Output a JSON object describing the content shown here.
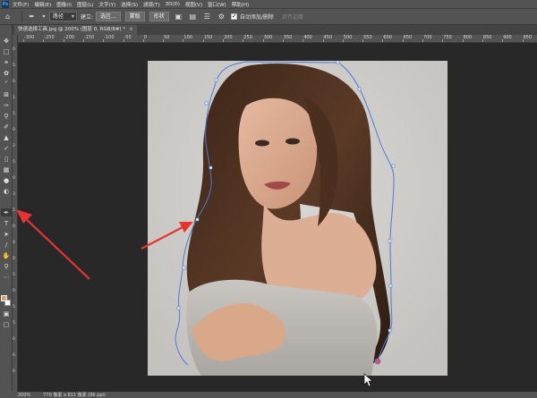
{
  "menubar": {
    "items": [
      "文件(F)",
      "编辑(E)",
      "图像(I)",
      "图层(L)",
      "文字(Y)",
      "选择(S)",
      "滤镜(T)",
      "3D(D)",
      "视图(V)",
      "窗口(W)",
      "帮助(H)"
    ]
  },
  "options": {
    "mode_select": "路径",
    "make_label": "建立:",
    "selection_btn": "选区...",
    "mask_btn": "蒙版",
    "shape_btn": "形状",
    "auto_add_label": "自动添加/删除",
    "align_edges_label": "对齐边缘"
  },
  "document": {
    "tab_title": "快速选择工具.jpg @ 200% (图层 0, RGB/8#) *"
  },
  "ruler": {
    "h_labels": [
      "-300",
      "-250",
      "-200",
      "-150",
      "-100",
      "-50",
      "0",
      "50",
      "100",
      "150",
      "200",
      "250",
      "300",
      "350",
      "400",
      "450",
      "500",
      "550",
      "600",
      "650",
      "700",
      "750",
      "800",
      "850",
      "900",
      "950"
    ],
    "v_labels": [
      "0",
      "5",
      "0",
      "1",
      "5",
      "0",
      "2",
      "5",
      "0",
      "3",
      "5",
      "0",
      "4",
      "0",
      "5",
      "0",
      "5",
      "5",
      "0",
      "6",
      "0"
    ]
  },
  "status": {
    "zoom": "200%",
    "doc_size": "770 像素 x 811 像素 (96 ppi)"
  },
  "colors": {
    "accent_arrow": "#e8332f",
    "path_line": "#4d7bd6",
    "fg_color": "#d9a37a"
  }
}
